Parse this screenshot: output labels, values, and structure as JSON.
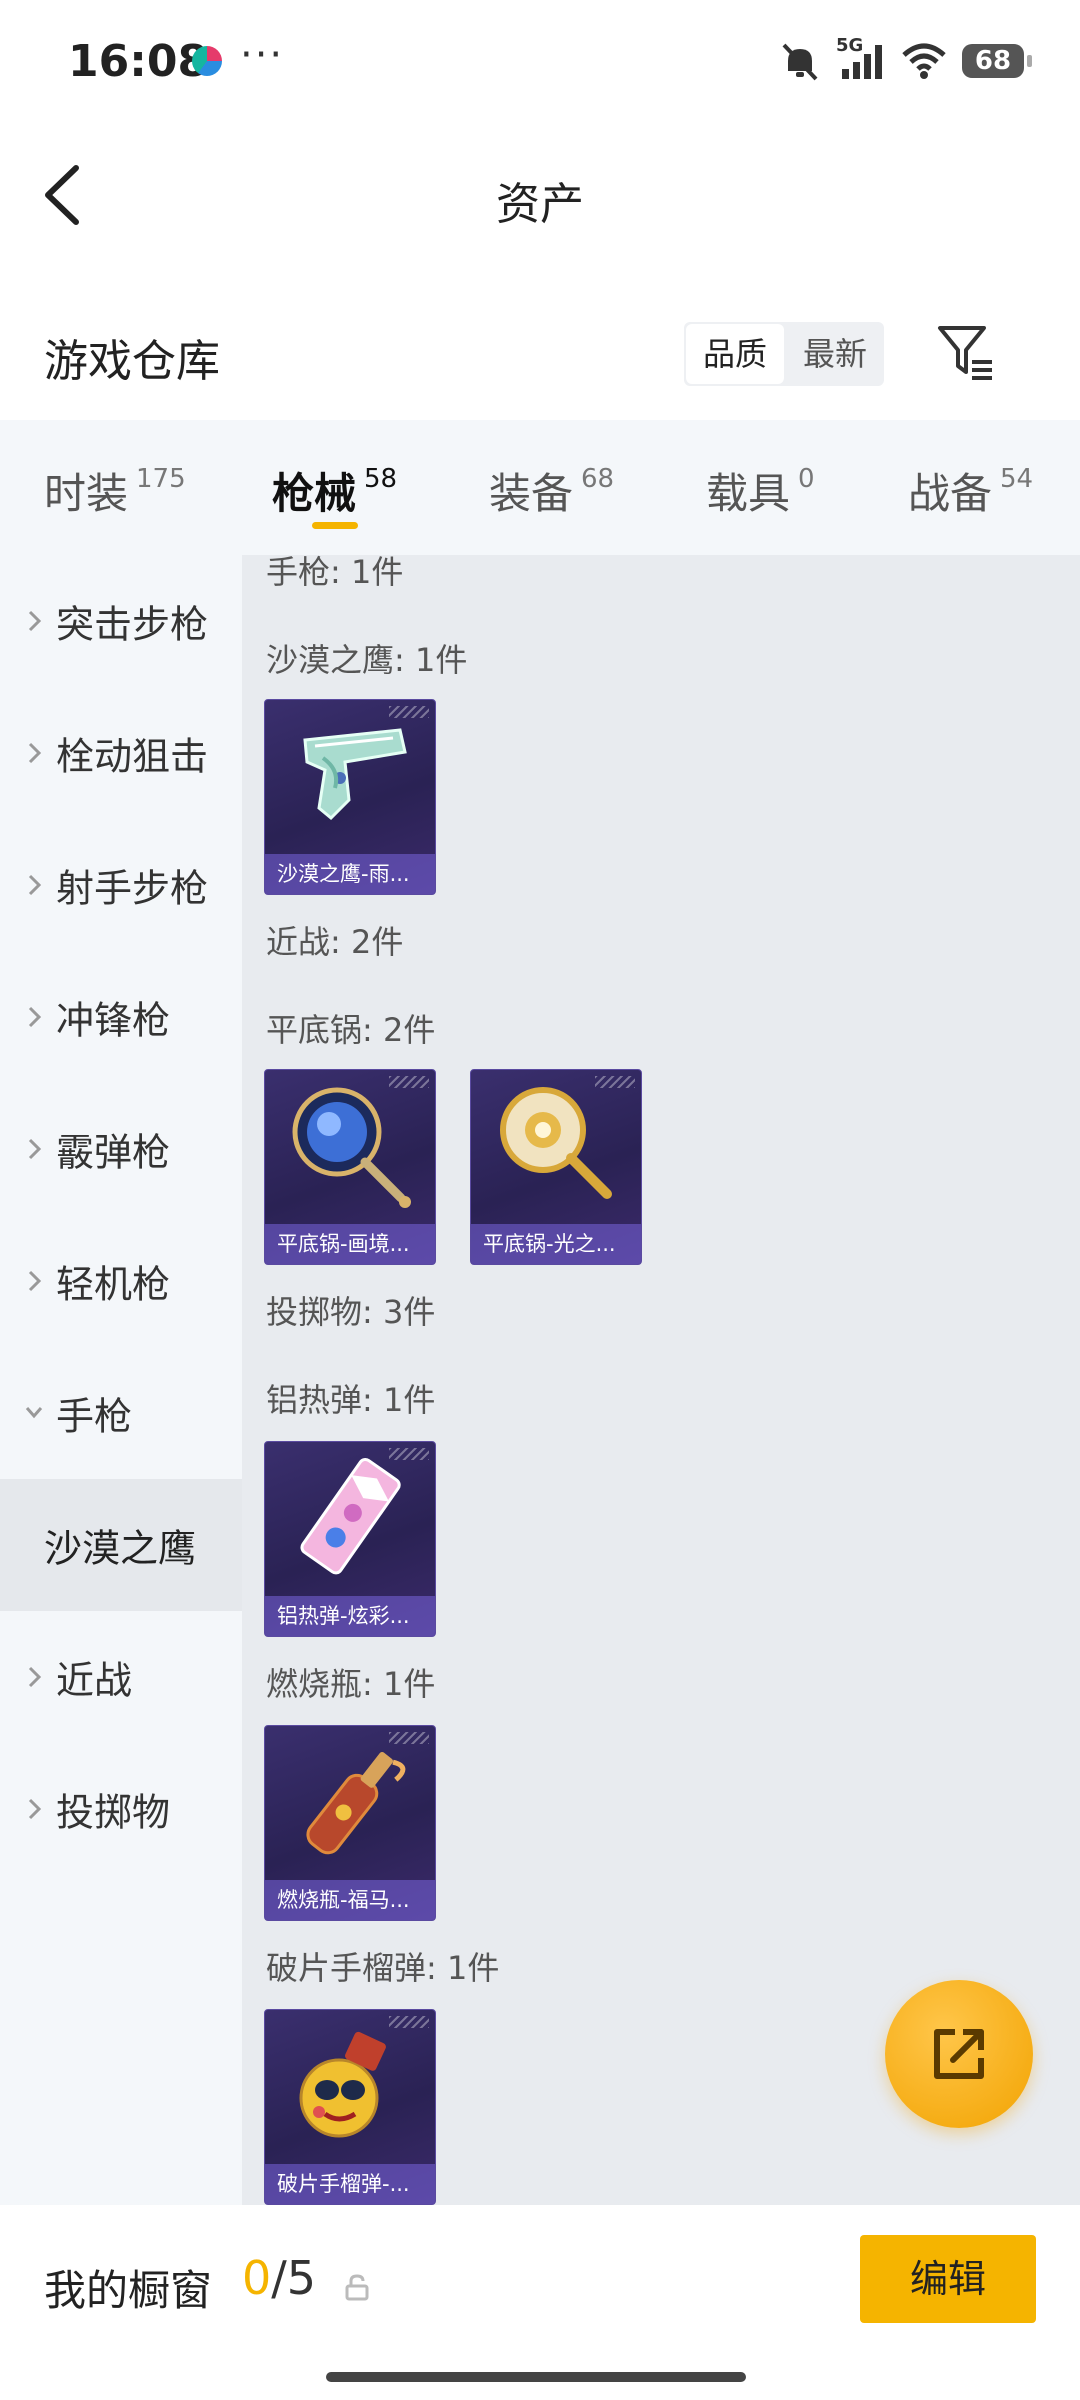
{
  "status_bar": {
    "time": "16:08",
    "more": "···",
    "network": "5G",
    "battery": "68",
    "icons": [
      "mute-icon",
      "signal-icon",
      "wifi-icon",
      "battery-icon"
    ]
  },
  "header": {
    "title": "资产",
    "back_icon": "back-arrow-icon"
  },
  "warehouse": {
    "title": "游戏仓库",
    "sort_options": [
      {
        "label": "品质",
        "active": true
      },
      {
        "label": "最新",
        "active": false
      }
    ],
    "filter_icon": "filter-icon"
  },
  "tabs": [
    {
      "label": "时装",
      "count": "175",
      "active": false
    },
    {
      "label": "枪械",
      "count": "58",
      "active": true
    },
    {
      "label": "装备",
      "count": "68",
      "active": false
    },
    {
      "label": "载具",
      "count": "0",
      "active": false
    },
    {
      "label": "战备",
      "count": "54",
      "active": false
    }
  ],
  "sidebar": {
    "items": [
      {
        "label": "突击步枪",
        "expanded": false
      },
      {
        "label": "栓动狙击",
        "expanded": false
      },
      {
        "label": "射手步枪",
        "expanded": false
      },
      {
        "label": "冲锋枪",
        "expanded": false
      },
      {
        "label": "霰弹枪",
        "expanded": false
      },
      {
        "label": "轻机枪",
        "expanded": false
      },
      {
        "label": "手枪",
        "expanded": true
      },
      {
        "label": "沙漠之鹰",
        "sub": true,
        "selected": true
      },
      {
        "label": "近战",
        "expanded": false
      },
      {
        "label": "投掷物",
        "expanded": false
      }
    ]
  },
  "content": {
    "labels": [
      "手枪: 1件",
      "沙漠之鹰: 1件",
      "近战: 2件",
      "平底锅: 2件",
      "投掷物: 3件",
      "铝热弹: 1件",
      "燃烧瓶: 1件",
      "破片手榴弹: 1件"
    ],
    "cards": [
      {
        "name": "沙漠之鹰-雨...",
        "icon": "desert-eagle-pistol-icon"
      },
      {
        "name": "平底锅-画境...",
        "icon": "frying-pan-blue-icon"
      },
      {
        "name": "平底锅-光之...",
        "icon": "frying-pan-gold-icon"
      },
      {
        "name": "铝热弹-炫彩...",
        "icon": "thermite-grenade-icon"
      },
      {
        "name": "燃烧瓶-福马...",
        "icon": "molotov-bottle-icon"
      },
      {
        "name": "破片手榴弹-...",
        "icon": "frag-grenade-icon"
      }
    ]
  },
  "fab": {
    "icon": "share-external-icon"
  },
  "bottom_bar": {
    "title": "我的橱窗",
    "count_current": "0",
    "count_sep": "/",
    "count_max": "5",
    "lock_icon": "lock-icon",
    "edit_label": "编辑"
  },
  "colors": {
    "accent": "#f5b400",
    "card_bg": "#2a2254",
    "card_label_bg": "#7864dc",
    "sidebar_bg": "#f4f7fa",
    "content_bg": "#e8ebef"
  }
}
